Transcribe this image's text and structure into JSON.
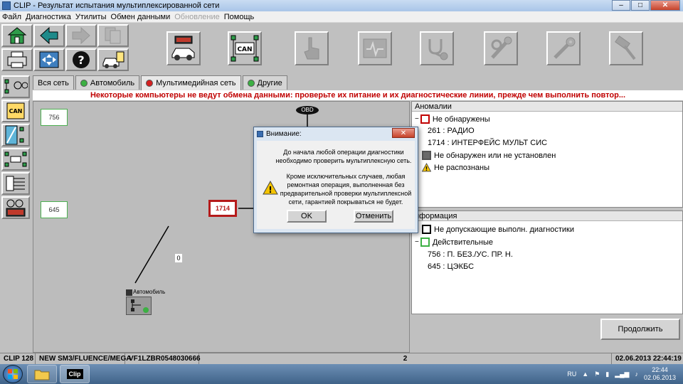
{
  "window": {
    "title": "CLIP - Результат испытания мультиплексированной сети",
    "minimize": "–",
    "maximize": "□",
    "close": "✕"
  },
  "menu": [
    "Файл",
    "Диагностика",
    "Утилиты",
    "Обмен данными",
    "Обновление",
    "Помощь"
  ],
  "toolbar": {
    "can_label": "CAN"
  },
  "left_toolbar": {
    "can_label": "CAN"
  },
  "tabs": [
    {
      "label": "Вся сеть",
      "dot": ""
    },
    {
      "label": "Автомобиль",
      "dot": "#3cb043"
    },
    {
      "label": "Мультимедийная сеть",
      "dot": "#d42020"
    },
    {
      "label": "Другие",
      "dot": "#3cb043"
    }
  ],
  "warning": "Некоторые компьютеры не ведут обмена данными: проверьте их питание и их диагностические линии, прежде чем выполнить повтор...",
  "network": {
    "obd_label": "OBD",
    "node_756": "756",
    "node_645": "645",
    "node_1714": "1714",
    "line_label": "0",
    "vehicle_label": "Автомобиль"
  },
  "anomalies": {
    "header": "Аномалии",
    "not_detected": "Не обнаружены",
    "items": [
      "261 : РАДИО",
      "1714 : ИНТЕРФЕЙС МУЛЬТ СИС"
    ],
    "not_found": "Не обнаружен или не установлен",
    "unrecognized": "Не распознаны"
  },
  "information": {
    "header": "нформация",
    "not_allowed": "Не допускающие выполн. диагностики",
    "valid": "Действительные",
    "items": [
      "756 : П. БЕЗ./УС. ПР. Н.",
      "645 : ЦЭКБС"
    ]
  },
  "continue_button": "Продолжить",
  "dialog": {
    "title": "Внимание:",
    "close": "✕",
    "text1_line1": "До начала любой операции диагностики",
    "text1_line2": "необходимо проверить мультиплексную сеть.",
    "text2_line1": "Кроме исключительных случаев, любая",
    "text2_line2": "ремонтная операция, выполненная без",
    "text2_line3": "предварительной проверки мультиплексной",
    "text2_line4": "сети, гарантией покрываться не будет.",
    "ok": "OK",
    "cancel": "Отменить"
  },
  "status": {
    "clip": "CLIP 128",
    "vehicle": "NEW SM3/FLUENCE/MEGA",
    "vin": "VF1LZBR0548030666",
    "count": "2",
    "datetime": "02.06.2013 22:44:19"
  },
  "taskbar": {
    "clip_label": "Clip",
    "lang": "RU",
    "time": "22:44",
    "date": "02.06.2013"
  },
  "colors": {
    "accent_red": "#b51a1a",
    "ok_green": "#3cb043"
  }
}
